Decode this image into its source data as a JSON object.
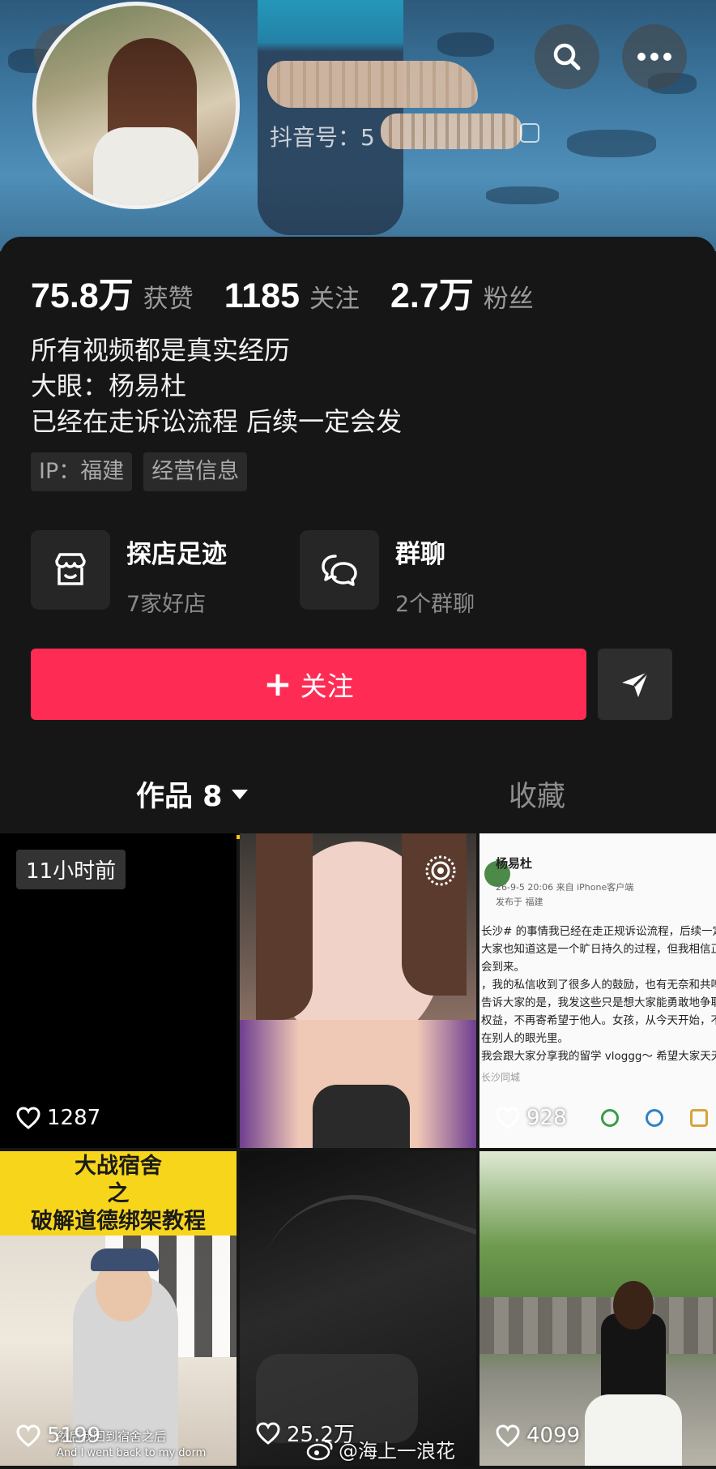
{
  "profile": {
    "id_label": "抖音号：5",
    "stats": [
      {
        "value": "75.8万",
        "label": "获赞"
      },
      {
        "value": "1185",
        "label": "关注"
      },
      {
        "value": "2.7万",
        "label": "粉丝"
      }
    ],
    "bio": [
      "所有视频都是真实经历",
      "大眼：杨易杜",
      "已经在走诉讼流程 后续一定会发"
    ],
    "tags": [
      "IP：福建",
      "经营信息"
    ]
  },
  "features": [
    {
      "title": "探店足迹",
      "subtitle": "7家好店",
      "icon": "shop-icon"
    },
    {
      "title": "群聊",
      "subtitle": "2个群聊",
      "icon": "chat-bubbles-icon"
    }
  ],
  "actions": {
    "follow_label": "关注",
    "follow_prefix": "+"
  },
  "tabs": {
    "works": "作品 8",
    "favorites": "收藏"
  },
  "posts": [
    {
      "time": "11小时前",
      "likes": "1287"
    },
    {
      "likes": ""
    },
    {
      "likes": "928",
      "doc_author": "杨易杜",
      "doc_meta": "26-9-5 20:06  来自 iPhone客户端",
      "doc_location": "发布于 福建",
      "doc_lines": [
        "长沙# 的事情我已经在走正规诉讼流程，后续一定会",
        "大家也知道这是一个旷日持久的过程，但我相信正",
        "会到来。",
        "，我的私信收到了很多人的鼓励，也有无奈和共鸣",
        "告诉大家的是，我发这些只是想大家能勇敢地争取",
        "权益，不再寄希望于他人。女孩，从今天开始，不",
        "在别人的眼光里。",
        "我会跟大家分享我的留学 vloggg～ 希望大家天天"
      ],
      "doc_footer": "长沙同城"
    },
    {
      "title_line1": "大战宿舍",
      "title_line2": "之",
      "title_line3": "破解道德绑架教程",
      "subtitle_cn": "然后我回到宿舍之后",
      "subtitle_en": "And I went back to my dorm",
      "likes": "5199"
    },
    {
      "likes": "25.2万"
    },
    {
      "likes": "4099"
    }
  ],
  "watermark": "@海上一浪花",
  "colors": {
    "accent": "#fe2c55",
    "tab_underline": "#f5c518",
    "background": "#161616"
  }
}
